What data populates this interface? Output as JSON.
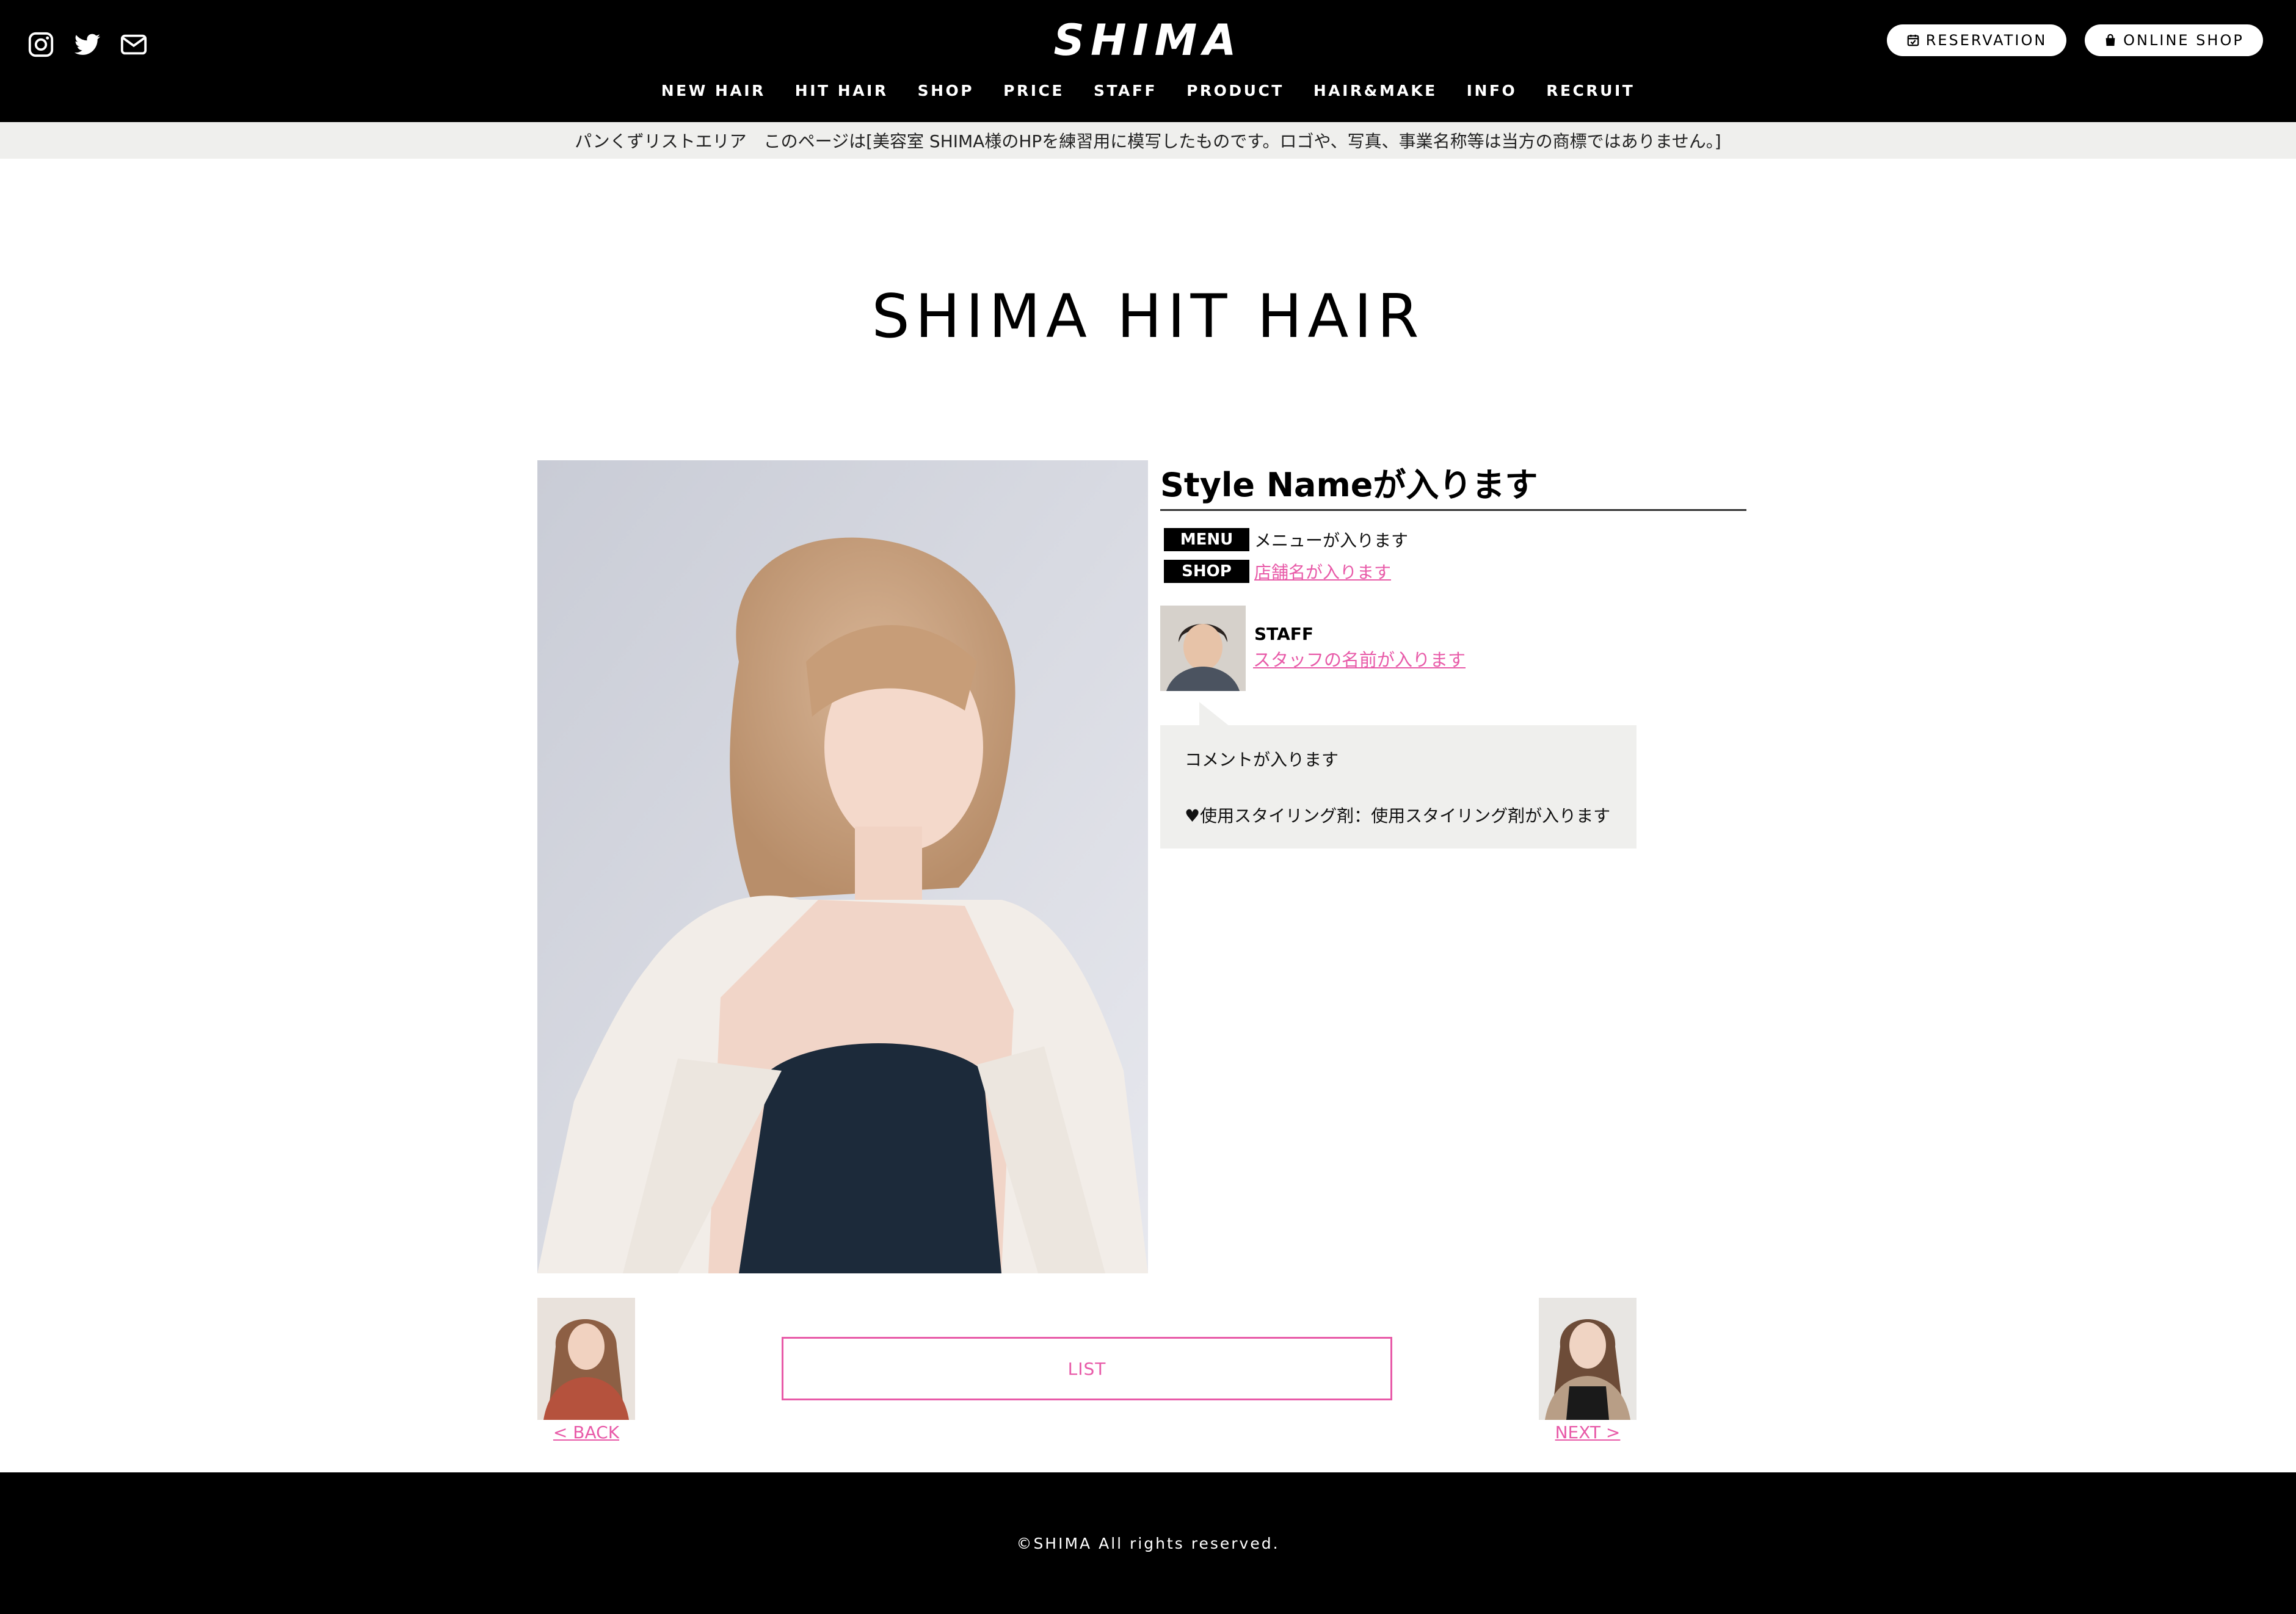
{
  "header": {
    "social_icons": [
      "instagram-icon",
      "twitter-icon",
      "mail-icon"
    ],
    "logo_text": "SHIMA",
    "reservation_label": "RESERVATION",
    "online_shop_label": "ONLINE SHOP",
    "nav": [
      "NEW HAIR",
      "HIT HAIR",
      "SHOP",
      "PRICE",
      "STAFF",
      "PRODUCT",
      "HAIR&MAKE",
      "INFO",
      "RECRUIT"
    ]
  },
  "breadcrumb": "パンくずリストエリア　このページは[美容室 SHIMA様のHPを練習用に模写したものです。ロゴや、写真、事業名称等は当方の商標ではありません。]",
  "page_title": "SHIMA HIT HAIR",
  "style": {
    "name": "Style Nameが入ります",
    "menu_tag": "MENU",
    "menu_value": "メニューが入ります",
    "shop_tag": "SHOP",
    "shop_value": "店舗名が入ります",
    "staff_label": "STAFF",
    "staff_name": "スタッフの名前が入ります",
    "comment": "コメントが入ります",
    "styling_note": "♥使用スタイリング剤：使用スタイリング剤が入ります"
  },
  "pager": {
    "back_label": "< BACK",
    "list_label": "LIST",
    "next_label": "NEXT >"
  },
  "footer": {
    "copyright": "©SHIMA All rights reserved."
  },
  "colors": {
    "header_bg": "#000000",
    "breadcrumb_bg": "#efefed",
    "accent_pink": "#e85aa8",
    "bubble_bg": "#efefed"
  }
}
